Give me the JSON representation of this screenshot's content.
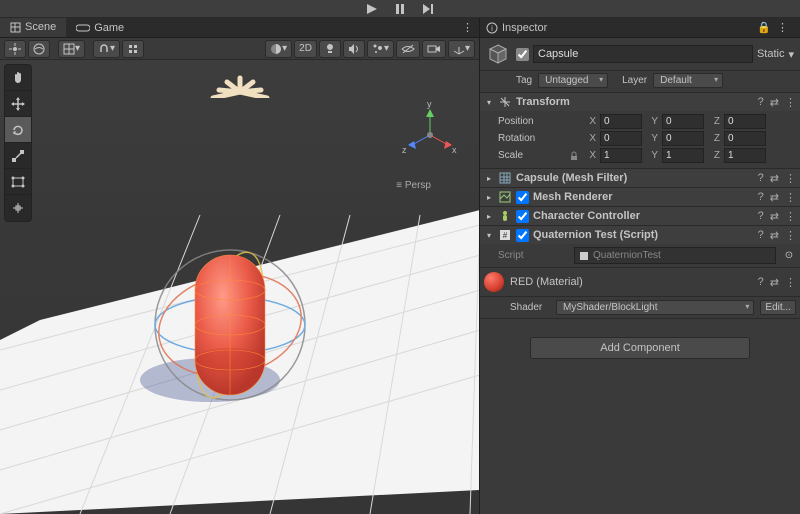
{
  "playback": {
    "play": "play",
    "pause": "pause",
    "step": "step"
  },
  "tabs": {
    "scene": "Scene",
    "game": "Game"
  },
  "toolbar": {
    "twoD": "2D"
  },
  "viewport": {
    "persp": "Persp",
    "axes": {
      "x": "x",
      "y": "y",
      "z": "z"
    }
  },
  "inspector": {
    "title": "Inspector",
    "object_name": "Capsule",
    "static_label": "Static",
    "tag_label": "Tag",
    "tag_value": "Untagged",
    "layer_label": "Layer",
    "layer_value": "Default"
  },
  "transform": {
    "title": "Transform",
    "position_label": "Position",
    "rotation_label": "Rotation",
    "scale_label": "Scale",
    "axes": {
      "x": "X",
      "y": "Y",
      "z": "Z"
    },
    "position": {
      "x": "0",
      "y": "0",
      "z": "0"
    },
    "rotation": {
      "x": "0",
      "y": "0",
      "z": "0"
    },
    "scale": {
      "x": "1",
      "y": "1",
      "z": "1"
    }
  },
  "components": {
    "mesh_filter": "Capsule (Mesh Filter)",
    "mesh_renderer": "Mesh Renderer",
    "character_controller": "Character Controller",
    "quaternion_test": "Quaternion Test (Script)",
    "script_label": "Script",
    "script_value": "QuaternionTest"
  },
  "material": {
    "name": "RED (Material)",
    "shader_label": "Shader",
    "shader_value": "MyShader/BlockLight",
    "edit": "Edit..."
  },
  "add_component": "Add Component",
  "glyphs": {
    "help": "?",
    "preset": "⇄",
    "menu": "⋮",
    "lock": "🔒",
    "target": "⊙",
    "arrow_down": "▾",
    "arrow_right": "▸",
    "persp_prefix": "≡"
  }
}
